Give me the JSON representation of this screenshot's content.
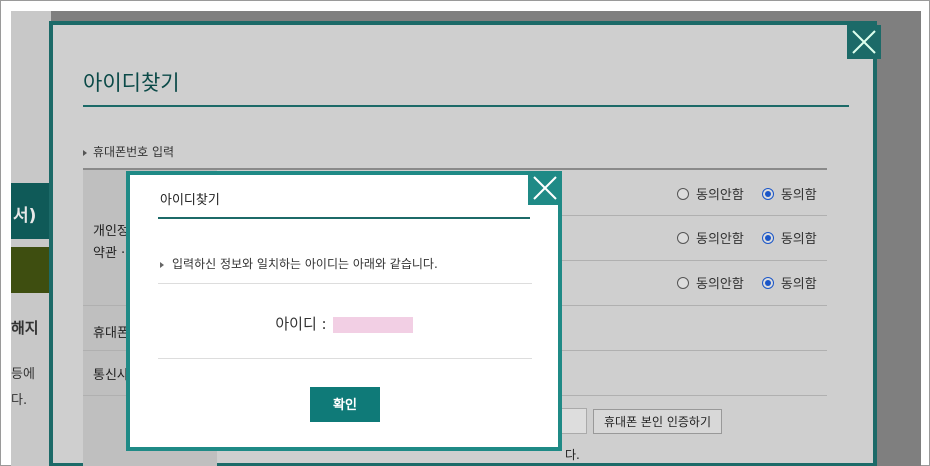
{
  "background": {
    "side_block_text": "서)",
    "side_heading": "해지",
    "side_line1": "등에",
    "side_line2": "다."
  },
  "outer_modal": {
    "title": "아이디찾기",
    "section_label": "휴대폰번호 입력",
    "rows": {
      "terms_label_line1": "개인정",
      "terms_label_line2": "약관 ·",
      "phone_label": "휴대폰",
      "carrier_label": "통신사"
    },
    "radio_disagree": "동의안함",
    "radio_agree": "동의함",
    "verify_button": "휴대폰 본인 인증하기",
    "trailing_text": "다."
  },
  "dialog": {
    "title": "아이디찾기",
    "message": "입력하신 정보와 일치하는 아이디는 아래와 같습니다.",
    "id_label": "아이디 :",
    "ok_button": "확인"
  },
  "colors": {
    "accent": "#1f8a86",
    "button": "#0f7a78",
    "id_mask": "#f2cfe4"
  }
}
